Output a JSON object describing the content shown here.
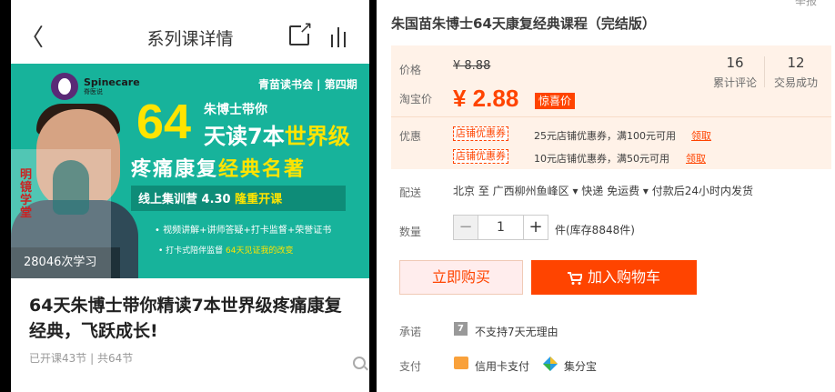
{
  "phone": {
    "back_glyph": "〈",
    "title": "系列课详情",
    "banner": {
      "logo_text": "Spinecare",
      "logo_sub": "脊医说",
      "tag": "青苗读书会 | 第四期",
      "big_num": "64",
      "line1": "朱博士带你",
      "line2_a": "天读7本",
      "line2_b": "世界级",
      "line3_a": "疼痛康复",
      "line3_b": "经典名著",
      "camp_a": "线上集训营  4.30 ",
      "camp_b": "隆重开课",
      "features": "• 视频讲解+讲师答疑+打卡监督+荣誉证书",
      "feature2_a": "• 打卡式陪伴监督 ",
      "feature2_b": "64天见证我的改变",
      "seal": "明\n镜\n学\n堂",
      "study_count": "28046次学习"
    },
    "course_title": "64天朱博士带你精读7本世界级疼痛康复经典，飞跃成长!",
    "course_meta": "已开课43节 | 共64节"
  },
  "product": {
    "title": "朱国苗朱博士64天康复经典课程（完结版）",
    "corner_text": "举报",
    "price_label": "价格",
    "old_price": "¥ 8.88",
    "tb_label": "淘宝价",
    "current_price": "¥ 2.88",
    "badge": "惊喜价",
    "stats": [
      {
        "num": "16",
        "label": "累计评论"
      },
      {
        "num": "12",
        "label": "交易成功"
      }
    ],
    "promo_label": "优惠",
    "coupons": [
      {
        "tag": "店铺优惠券",
        "text": "25元店铺优惠券，满100元可用",
        "link": "领取"
      },
      {
        "tag": "店铺优惠券",
        "text": "10元店铺优惠券，满50元可用",
        "link": "领取"
      }
    ],
    "ship_label": "配送",
    "ship_text": "北京 至  广西柳州鱼峰区 ▾   快递 免运费 ▾   付款后24小时内发货",
    "qty_label": "数量",
    "qty_value": "1",
    "qty_minus": "−",
    "qty_plus": "+",
    "stock": "件(库存8848件)",
    "buy_now": "立即购买",
    "add_cart": "加入购物车",
    "promise_label": "承诺",
    "promise_icon": "7",
    "promise_text": "不支持7天无理由",
    "pay_label": "支付",
    "pay1": "信用卡支付",
    "pay2": "集分宝"
  }
}
